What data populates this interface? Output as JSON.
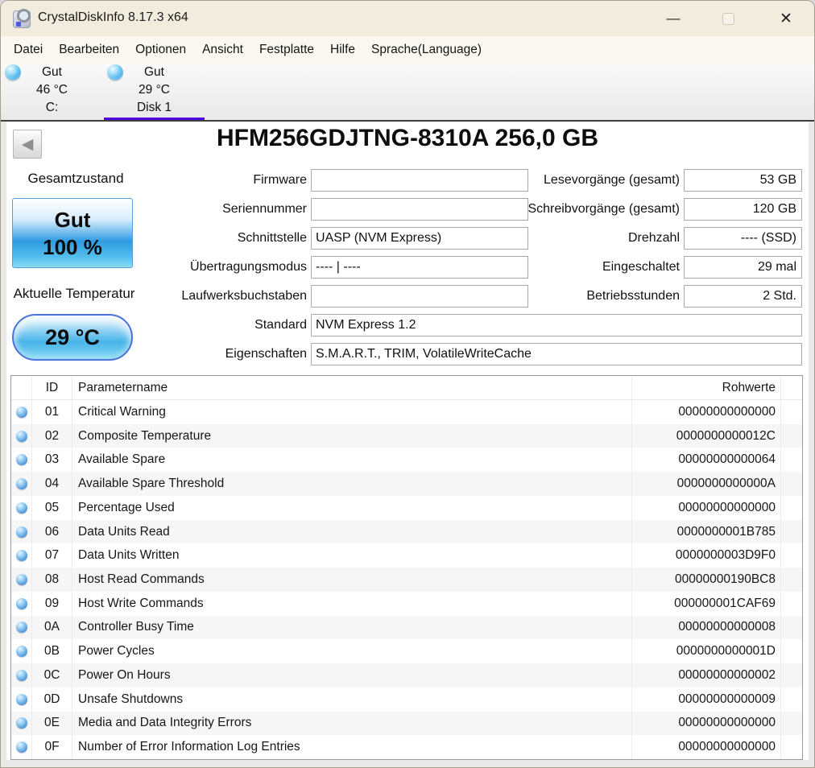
{
  "window": {
    "title": "CrystalDiskInfo 8.17.3 x64",
    "controls": {
      "minimize": "—",
      "close": "✕"
    }
  },
  "icons": {
    "back": "◀"
  },
  "menu": {
    "items": [
      "Datei",
      "Bearbeiten",
      "Optionen",
      "Ansicht",
      "Festplatte",
      "Hilfe",
      "Sprache(Language)"
    ]
  },
  "drive_tabs": [
    {
      "status": "Gut",
      "temp": "46 °C",
      "name": "C:",
      "selected": false
    },
    {
      "status": "Gut",
      "temp": "29 °C",
      "name": "Disk 1",
      "selected": true
    }
  ],
  "drive": {
    "title": "HFM256GDJTNG-8310A 256,0 GB",
    "health": {
      "label": "Gesamtzustand",
      "status": "Gut",
      "percent": "100 %"
    },
    "temperature": {
      "label": "Aktuelle Temperatur",
      "value": "29 °C"
    },
    "fields_left": [
      {
        "label": "Firmware",
        "value": ""
      },
      {
        "label": "Seriennummer",
        "value": ""
      },
      {
        "label": "Schnittstelle",
        "value": "UASP (NVM Express)"
      },
      {
        "label": "Übertragungsmodus",
        "value": "---- | ----"
      },
      {
        "label": "Laufwerksbuchstaben",
        "value": ""
      }
    ],
    "fields_wide": [
      {
        "label": "Standard",
        "value": "NVM Express 1.2"
      },
      {
        "label": "Eigenschaften",
        "value": "S.M.A.R.T., TRIM, VolatileWriteCache"
      }
    ],
    "fields_right": [
      {
        "label": "Lesevorgänge (gesamt)",
        "value": "53 GB"
      },
      {
        "label": "Schreibvorgänge (gesamt)",
        "value": "120 GB"
      },
      {
        "label": "Drehzahl",
        "value": "---- (SSD)"
      },
      {
        "label": "Eingeschaltet",
        "value": "29 mal"
      },
      {
        "label": "Betriebsstunden",
        "value": "2 Std."
      }
    ]
  },
  "smart_table": {
    "headers": {
      "id": "ID",
      "name": "Parametername",
      "raw": "Rohwerte"
    },
    "rows": [
      {
        "id": "01",
        "name": "Critical Warning",
        "raw": "00000000000000"
      },
      {
        "id": "02",
        "name": "Composite Temperature",
        "raw": "0000000000012C"
      },
      {
        "id": "03",
        "name": "Available Spare",
        "raw": "00000000000064"
      },
      {
        "id": "04",
        "name": "Available Spare Threshold",
        "raw": "0000000000000A"
      },
      {
        "id": "05",
        "name": "Percentage Used",
        "raw": "00000000000000"
      },
      {
        "id": "06",
        "name": "Data Units Read",
        "raw": "0000000001B785"
      },
      {
        "id": "07",
        "name": "Data Units Written",
        "raw": "0000000003D9F0"
      },
      {
        "id": "08",
        "name": "Host Read Commands",
        "raw": "00000000190BC8"
      },
      {
        "id": "09",
        "name": "Host Write Commands",
        "raw": "000000001CAF69"
      },
      {
        "id": "0A",
        "name": "Controller Busy Time",
        "raw": "00000000000008"
      },
      {
        "id": "0B",
        "name": "Power Cycles",
        "raw": "0000000000001D"
      },
      {
        "id": "0C",
        "name": "Power On Hours",
        "raw": "00000000000002"
      },
      {
        "id": "0D",
        "name": "Unsafe Shutdowns",
        "raw": "00000000000009"
      },
      {
        "id": "0E",
        "name": "Media and Data Integrity Errors",
        "raw": "00000000000000"
      },
      {
        "id": "0F",
        "name": "Number of Error Information Log Entries",
        "raw": "00000000000000"
      }
    ]
  },
  "colors": {
    "titlebar_bg": "#f2ecdf",
    "selected_tab_underline": "#4d00e0",
    "health_blue": "#2f9be2"
  }
}
